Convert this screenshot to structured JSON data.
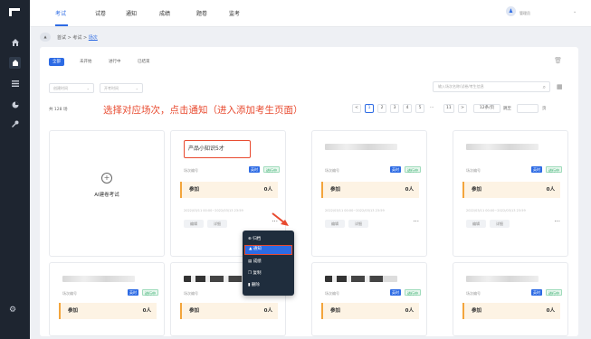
{
  "topbar": {
    "tabs": [
      "考试",
      "试卷",
      "通知",
      "成绩",
      "题卷",
      "监考"
    ],
    "user_avatar": "♟",
    "user_name": "管理员"
  },
  "breadcrumb": {
    "home": "▲",
    "items": [
      "首试",
      "考试",
      "场次"
    ]
  },
  "filters": {
    "segments": [
      "全部",
      "未开始",
      "进行中",
      "已结束"
    ],
    "create_time_placeholder": "创建时间",
    "exam_time_placeholder": "开考时间",
    "search_placeholder": "输入场次名称/试卷/考生信息"
  },
  "list": {
    "total": "共 128 场",
    "instruction": "选择对应场次，点击通知（进入添加考生页面）"
  },
  "pagination": {
    "pages": [
      "1",
      "2",
      "3",
      "4",
      "5",
      "11"
    ],
    "ellipsis": "···",
    "page_size": "12条/页",
    "goto_label": "跳至",
    "page_suffix": "页"
  },
  "ai_card": {
    "label": "AI建卷考试"
  },
  "cards": [
    {
      "name": "产品小知识5才",
      "code": "场次编号",
      "type": "英时",
      "status": "进行中",
      "join_label": "参加",
      "count": "0人",
      "time": "2022/03/11 00:00~2022/03/13 23:59",
      "btn1": "编辑",
      "btn2": "详细"
    },
    {
      "name": "",
      "code": "场次编号",
      "type": "英时",
      "status": "进行中",
      "join_label": "参加",
      "count": "0人",
      "time": "2022/03/11 00:00~2022/03/13 23:59",
      "btn1": "编辑",
      "btn2": "详细"
    },
    {
      "name": "",
      "code": "场次编号",
      "type": "英时",
      "status": "进行中",
      "join_label": "参加",
      "count": "0人",
      "time": "2022/03/11 00:00~2022/03/13 23:59",
      "btn1": "编辑",
      "btn2": "详细"
    },
    {
      "name": "",
      "code": "场次编号",
      "type": "英时",
      "status": "进行中",
      "join_label": "参加",
      "count": "0人"
    },
    {
      "name": "",
      "code": "场次编号",
      "type": "",
      "status": "",
      "join_label": "参加",
      "count": "0人"
    },
    {
      "name": "",
      "code": "场次编号",
      "type": "英时",
      "status": "进行中",
      "join_label": "参加",
      "count": "0人"
    },
    {
      "name": "",
      "code": "场次编号",
      "type": "英时",
      "status": "进行中",
      "join_label": "参加",
      "count": "0人"
    }
  ],
  "dropdown": {
    "items": [
      "归档",
      "通知",
      "成绩",
      "复制",
      "删除"
    ],
    "highlighted": "通知"
  },
  "colors": {
    "accent": "#2d6be4",
    "annotation": "#e84a2f",
    "sidebar": "#1e2530"
  }
}
